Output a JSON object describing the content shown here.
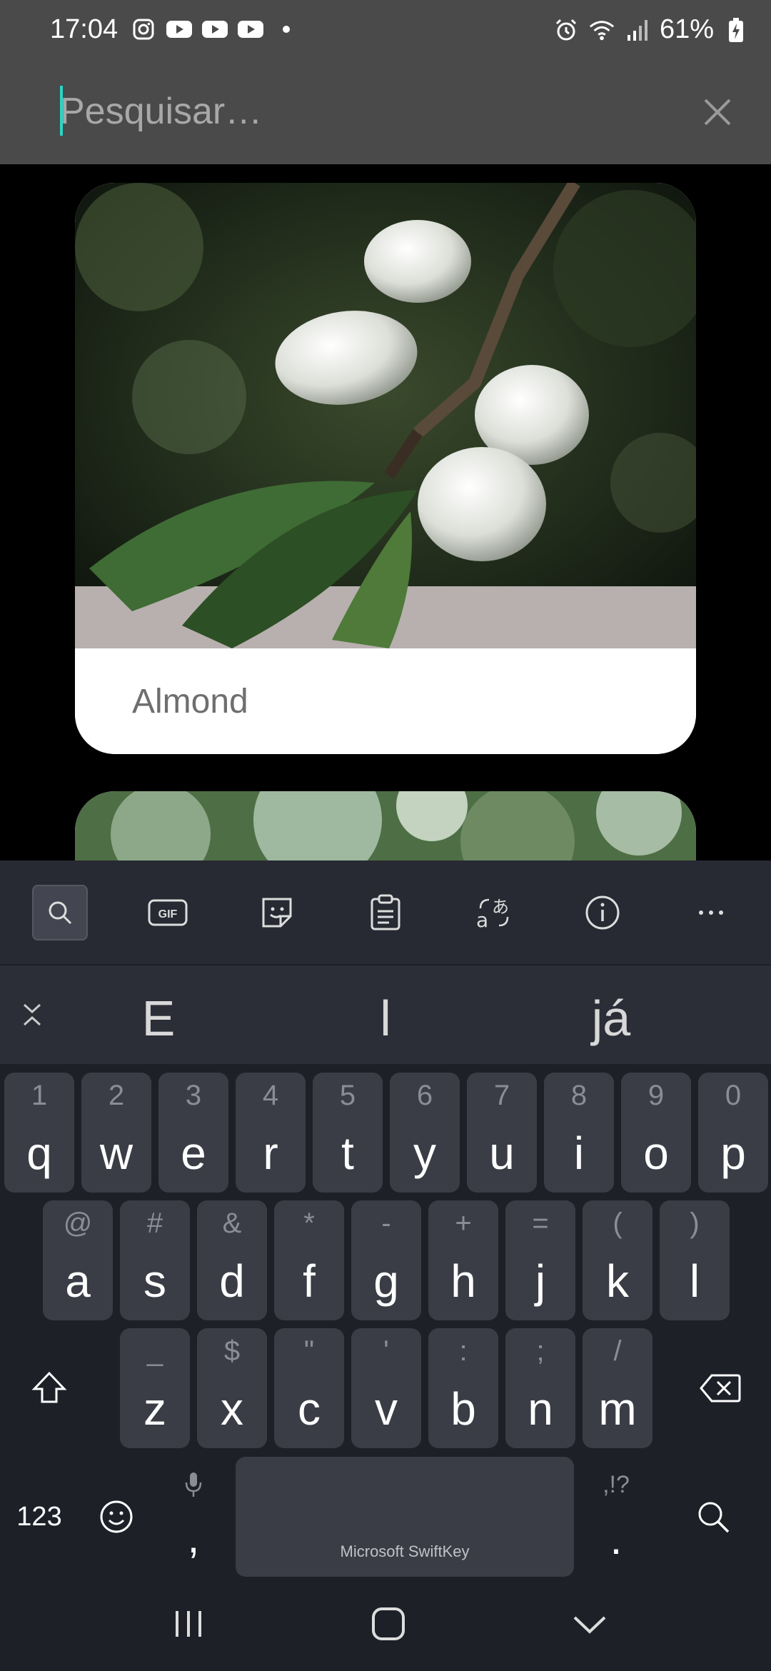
{
  "status_bar": {
    "time": "17:04",
    "battery": "61%",
    "left_icons": [
      "instagram-icon",
      "youtube-icon",
      "youtube-icon",
      "youtube-icon",
      "dot-icon"
    ],
    "right_icons": [
      "alarm-icon",
      "wifi-icon",
      "signal-icon",
      "battery-charging-icon"
    ]
  },
  "search": {
    "placeholder": "Pesquisar…",
    "value": ""
  },
  "results": [
    {
      "label": "Almond"
    },
    {
      "label": ""
    }
  ],
  "keyboard": {
    "toolbar": [
      "search-icon",
      "gif-icon",
      "sticker-icon",
      "clipboard-icon",
      "translate-icon",
      "info-icon",
      "more-icon"
    ],
    "toolbar_gif_label": "GIF",
    "suggestions": [
      "E",
      "l",
      "já"
    ],
    "row1": [
      {
        "hint": "1",
        "key": "q"
      },
      {
        "hint": "2",
        "key": "w"
      },
      {
        "hint": "3",
        "key": "e"
      },
      {
        "hint": "4",
        "key": "r"
      },
      {
        "hint": "5",
        "key": "t"
      },
      {
        "hint": "6",
        "key": "y"
      },
      {
        "hint": "7",
        "key": "u"
      },
      {
        "hint": "8",
        "key": "i"
      },
      {
        "hint": "9",
        "key": "o"
      },
      {
        "hint": "0",
        "key": "p"
      }
    ],
    "row2": [
      {
        "hint": "@",
        "key": "a"
      },
      {
        "hint": "#",
        "key": "s"
      },
      {
        "hint": "&",
        "key": "d"
      },
      {
        "hint": "*",
        "key": "f"
      },
      {
        "hint": "-",
        "key": "g"
      },
      {
        "hint": "+",
        "key": "h"
      },
      {
        "hint": "=",
        "key": "j"
      },
      {
        "hint": "(",
        "key": "k"
      },
      {
        "hint": ")",
        "key": "l"
      }
    ],
    "row3": [
      {
        "hint": "_",
        "key": "z"
      },
      {
        "hint": "$",
        "key": "x"
      },
      {
        "hint": "\"",
        "key": "c"
      },
      {
        "hint": "'",
        "key": "v"
      },
      {
        "hint": ":",
        "key": "b"
      },
      {
        "hint": ";",
        "key": "n"
      },
      {
        "hint": "/",
        "key": "m"
      }
    ],
    "numbers_label": "123",
    "comma_label": ",",
    "period_label": ".",
    "period_hint": ",!?",
    "space_label": "Microsoft SwiftKey"
  },
  "colors": {
    "accent_cursor": "#2ad4c4",
    "keyboard_bg": "#1e2028",
    "key_bg": "#3a3d46"
  }
}
